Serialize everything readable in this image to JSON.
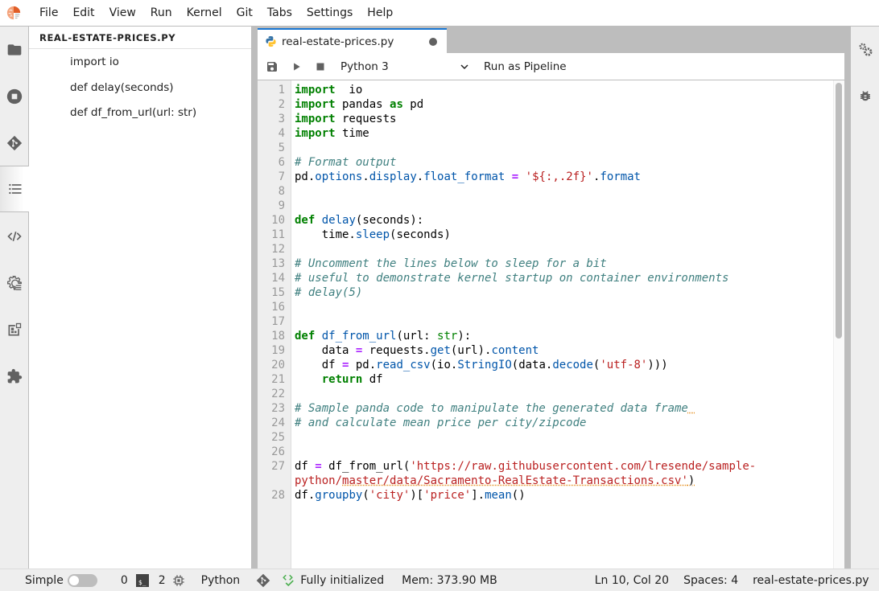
{
  "menubar": {
    "items": [
      "File",
      "Edit",
      "View",
      "Run",
      "Kernel",
      "Git",
      "Tabs",
      "Settings",
      "Help"
    ]
  },
  "left_bar": {
    "icons": [
      "folder-icon",
      "running-icon",
      "git-icon",
      "table-of-contents-icon",
      "code-snippets-icon",
      "runtimes-icon",
      "component-catalog-icon",
      "extensions-icon"
    ],
    "active": "table-of-contents-icon"
  },
  "toc": {
    "title": "REAL-ESTATE-PRICES.PY",
    "items": [
      "import io",
      "def delay(seconds)",
      "def df_from_url(url: str)"
    ]
  },
  "tab": {
    "label": "real-estate-prices.py",
    "dirty": true
  },
  "toolbar": {
    "save_tooltip": "Save",
    "run_tooltip": "Run",
    "stop_tooltip": "Stop",
    "kernel": "Python 3",
    "run_pipeline_label": "Run as Pipeline"
  },
  "editor": {
    "lines": [
      {
        "n": "1",
        "tokens": [
          [
            "kw",
            "import"
          ],
          [
            "",
            "  io"
          ]
        ]
      },
      {
        "n": "2",
        "tokens": [
          [
            "kw",
            "import"
          ],
          [
            "",
            " pandas "
          ],
          [
            "kw",
            "as"
          ],
          [
            "",
            " pd"
          ]
        ]
      },
      {
        "n": "3",
        "tokens": [
          [
            "kw",
            "import"
          ],
          [
            "",
            " requests"
          ]
        ]
      },
      {
        "n": "4",
        "tokens": [
          [
            "kw",
            "import"
          ],
          [
            "",
            " time"
          ]
        ]
      },
      {
        "n": "5",
        "tokens": []
      },
      {
        "n": "6",
        "tokens": [
          [
            "cm",
            "# Format output"
          ]
        ]
      },
      {
        "n": "7",
        "tokens": [
          [
            "",
            "pd."
          ],
          [
            "prop",
            "options"
          ],
          [
            "",
            "."
          ],
          [
            "prop",
            "display"
          ],
          [
            "",
            "."
          ],
          [
            "prop",
            "float_format"
          ],
          [
            "",
            " "
          ],
          [
            "op",
            "="
          ],
          [
            "",
            " "
          ],
          [
            "str",
            "'${:,.2f}'"
          ],
          [
            "",
            "."
          ],
          [
            "prop",
            "format"
          ]
        ]
      },
      {
        "n": "8",
        "tokens": []
      },
      {
        "n": "9",
        "tokens": []
      },
      {
        "n": "10",
        "tokens": [
          [
            "kw",
            "def"
          ],
          [
            "",
            " "
          ],
          [
            "fn",
            "delay"
          ],
          [
            "",
            "(seconds):"
          ]
        ]
      },
      {
        "n": "11",
        "tokens": [
          [
            "",
            "    time."
          ],
          [
            "prop",
            "sleep"
          ],
          [
            "",
            "(seconds)"
          ]
        ]
      },
      {
        "n": "12",
        "tokens": []
      },
      {
        "n": "13",
        "tokens": [
          [
            "cm",
            "# Uncomment the lines below to sleep for a bit"
          ]
        ]
      },
      {
        "n": "14",
        "tokens": [
          [
            "cm",
            "# useful to demonstrate kernel startup on container environments"
          ]
        ]
      },
      {
        "n": "15",
        "tokens": [
          [
            "cm",
            "# delay(5)"
          ]
        ]
      },
      {
        "n": "16",
        "tokens": []
      },
      {
        "n": "17",
        "tokens": []
      },
      {
        "n": "18",
        "tokens": [
          [
            "kw",
            "def"
          ],
          [
            "",
            " "
          ],
          [
            "fn",
            "df_from_url"
          ],
          [
            "",
            "(url: "
          ],
          [
            "bi",
            "str"
          ],
          [
            "",
            "):"
          ]
        ]
      },
      {
        "n": "19",
        "tokens": [
          [
            "",
            "    data "
          ],
          [
            "op",
            "="
          ],
          [
            "",
            " requests."
          ],
          [
            "prop",
            "get"
          ],
          [
            "",
            "(url)."
          ],
          [
            "prop",
            "content"
          ]
        ]
      },
      {
        "n": "20",
        "tokens": [
          [
            "",
            "    df "
          ],
          [
            "op",
            "="
          ],
          [
            "",
            " pd."
          ],
          [
            "prop",
            "read_csv"
          ],
          [
            "",
            "(io."
          ],
          [
            "prop",
            "StringIO"
          ],
          [
            "",
            "(data."
          ],
          [
            "prop",
            "decode"
          ],
          [
            "",
            "("
          ],
          [
            "str",
            "'utf-8'"
          ],
          [
            "",
            ")))"
          ]
        ]
      },
      {
        "n": "21",
        "tokens": [
          [
            "",
            "    "
          ],
          [
            "kw",
            "return"
          ],
          [
            "",
            " df"
          ]
        ]
      },
      {
        "n": "22",
        "tokens": []
      },
      {
        "n": "23",
        "tokens": [
          [
            "cm",
            "# Sample panda code to manipulate the generated data frame"
          ],
          [
            "squig",
            " "
          ]
        ]
      },
      {
        "n": "24",
        "tokens": [
          [
            "cm",
            "# and calculate mean price per city/zipcode"
          ]
        ]
      },
      {
        "n": "25",
        "tokens": []
      },
      {
        "n": "26",
        "tokens": []
      },
      {
        "n": "27",
        "tokens": [
          [
            "",
            "df "
          ],
          [
            "op",
            "="
          ],
          [
            "",
            " df_from_url("
          ],
          [
            "str",
            "'https://raw.githubusercontent.com/lresende/sample-"
          ]
        ]
      },
      {
        "n": "",
        "tokens": [
          [
            "str",
            "python/"
          ],
          [
            "str squig",
            "master/data/Sacramento-RealEstate-Transactions.csv'"
          ],
          [
            "squig",
            ")"
          ]
        ]
      },
      {
        "n": "28",
        "tokens": [
          [
            "",
            "df."
          ],
          [
            "prop",
            "groupby"
          ],
          [
            "",
            "("
          ],
          [
            "str",
            "'city'"
          ],
          [
            "",
            ")["
          ],
          [
            "str",
            "'price'"
          ],
          [
            "",
            "]."
          ],
          [
            "prop",
            "mean"
          ],
          [
            "",
            "()"
          ]
        ]
      }
    ]
  },
  "right_bar": {
    "icons": [
      "property-inspector-icon",
      "debugger-icon"
    ]
  },
  "statusbar": {
    "mode_label": "Simple",
    "mode_enabled": false,
    "terminals_count": "0",
    "kernels_count": "2",
    "kernel_language": "Python",
    "lsp_status": "Fully initialized",
    "memory": "Mem: 373.90 MB",
    "cursor": "Ln 10, Col 20",
    "indent": "Spaces: 4",
    "filename": "real-estate-prices.py"
  }
}
